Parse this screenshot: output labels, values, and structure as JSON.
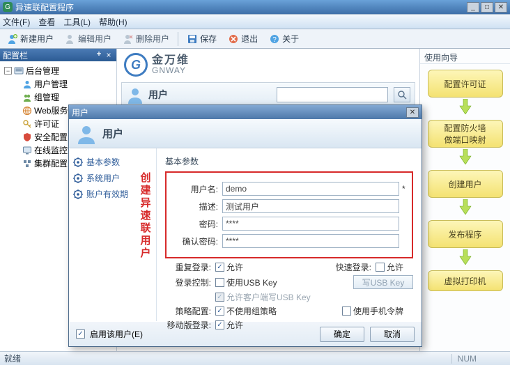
{
  "window": {
    "title": "异速联配置程序"
  },
  "menubar": {
    "file": "文件(F)",
    "view": "查看",
    "tools": "工具(L)",
    "help": "帮助(H)"
  },
  "toolbar": {
    "new_user": "新建用户",
    "edit_user": "编辑用户",
    "delete_user": "删除用户",
    "save": "保存",
    "exit": "退出",
    "about": "关于"
  },
  "sidebar": {
    "panel_title": "配置栏",
    "root": "后台管理",
    "items": [
      "用户管理",
      "组管理",
      "Web服务器",
      "许可证",
      "安全配置",
      "在线监控",
      "集群配置"
    ]
  },
  "brand": {
    "cjk": "金万维",
    "latin": "GNWAY"
  },
  "user_strip": {
    "label": "用户"
  },
  "wizard": {
    "title": "使用向导",
    "steps": [
      "配置许可证",
      "配置防火墙\n做端口映射",
      "创建用户",
      "发布程序",
      "虚拟打印机"
    ]
  },
  "dialog": {
    "title": "用户",
    "banner": "用户",
    "nav": {
      "basic": "基本参数",
      "sys_user": "系统用户",
      "account_valid": "账户有效期"
    },
    "vbanner": "创建异速联用户",
    "section_title": "基本参数",
    "fields": {
      "username_label": "用户名:",
      "username_value": "demo",
      "desc_label": "描述:",
      "desc_value": "测试用户",
      "pwd_label": "密码:",
      "pwd_value": "****",
      "pwd2_label": "确认密码:",
      "pwd2_value": "****"
    },
    "opts": {
      "relogin_label": "重复登录:",
      "relogin_allow": "允许",
      "fastlogin_label": "快速登录:",
      "fastlogin_allow": "允许",
      "login_ctrl_label": "登录控制:",
      "use_usb": "使用USB Key",
      "write_usb_btn": "写USB Key",
      "allow_client_usb": "允许客户端写USB Key",
      "policy_label": "策略配置:",
      "no_group_policy": "不使用组策略",
      "use_phone_token": "使用手机令牌",
      "mobile_login_label": "移动版登录:",
      "mobile_allow": "允许"
    },
    "footer": {
      "enable_user": "启用该用户(E)",
      "ok": "确定",
      "cancel": "取消"
    }
  },
  "statusbar": {
    "ready": "就绪",
    "num": "NUM"
  }
}
